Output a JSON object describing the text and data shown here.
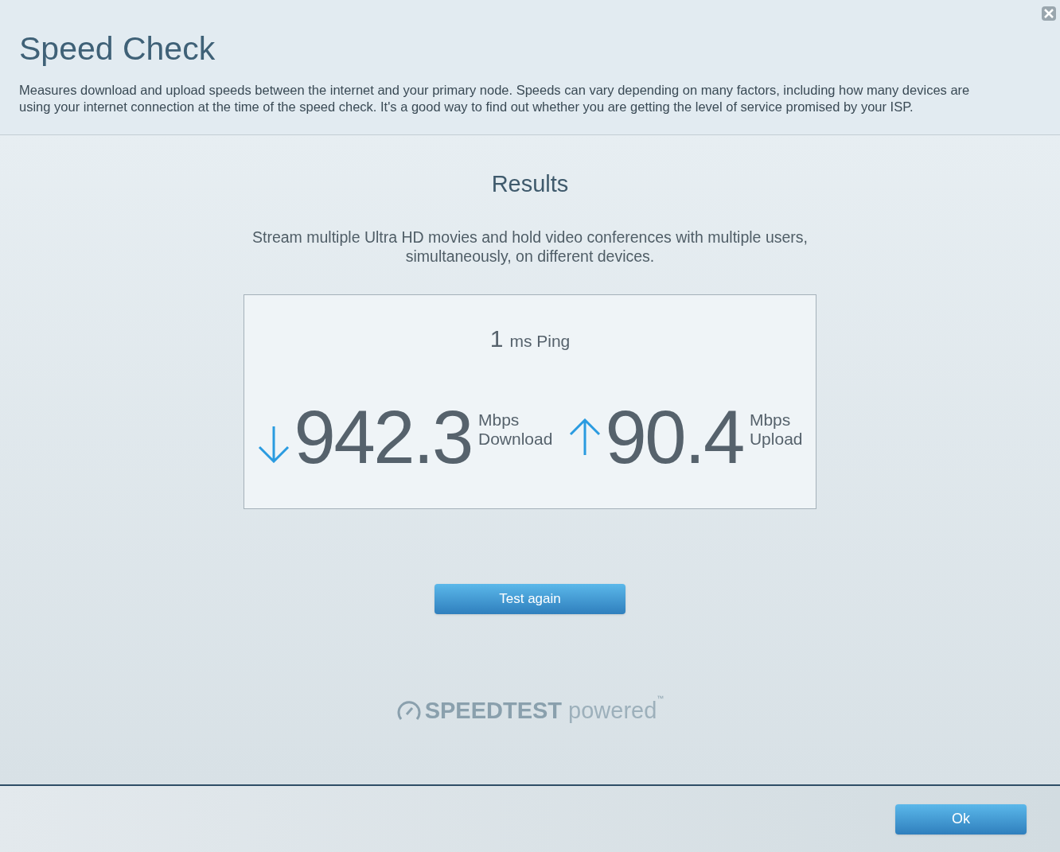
{
  "title": "Speed Check",
  "description": "Measures download and upload speeds between the internet and your primary node. Speeds can vary depending on many factors, including how many devices are using your internet connection at the time of the speed check. It's a good way to find out whether you are getting the level of service promised by your ISP.",
  "results": {
    "heading": "Results",
    "summary": "Stream multiple Ultra HD movies and hold video conferences with multiple users, simultaneously, on different devices.",
    "ping": {
      "value": "1",
      "label": "ms Ping"
    },
    "speeds": [
      {
        "kind": "download",
        "value": "942.3",
        "unit": "Mbps",
        "label": "Download"
      },
      {
        "kind": "upload",
        "value": "90.4",
        "unit": "Mbps",
        "label": "Upload"
      }
    ]
  },
  "test_button": "Test again",
  "logo": {
    "brand": "SPEEDTEST",
    "suffix": "powered",
    "tm": "™"
  },
  "ok_button": "Ok"
}
